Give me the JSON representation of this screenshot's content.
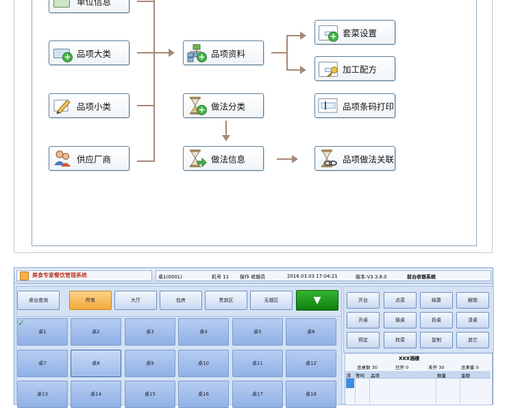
{
  "flow": {
    "nodes": {
      "unit_info": "单位信息",
      "item_category": "品项大类",
      "item_subcategory": "品项小类",
      "supplier": "供应厂商",
      "item_data": "品项资料",
      "method_category": "做法分类",
      "method_info": "做法信息",
      "set_meal": "套菜设置",
      "processing_recipe": "加工配方",
      "barcode_print": "品项条码打印",
      "item_method_link": "品项做法关联"
    }
  },
  "pos": {
    "app_title": "美食专家餐饮管理系统",
    "table_label": "桌1(0001)",
    "machine": "机号 11",
    "operator": "操作 收银员",
    "datetime": "2016.03.03 17:04:21",
    "version": "版本:V3.3.8.0",
    "system_name": "前台收银系统",
    "query_button": "桌台查询",
    "zones": [
      "所有",
      "大厅",
      "包房",
      "贵宾区",
      "无烟区"
    ],
    "tables": [
      "桌1",
      "桌2",
      "桌3",
      "桌4",
      "桌5",
      "桌6",
      "桌7",
      "桌8",
      "桌9",
      "桌10",
      "桌11",
      "桌12",
      "桌13",
      "桌14",
      "桌15",
      "桌16",
      "桌17",
      "桌18"
    ],
    "actions": [
      "开台",
      "点菜",
      "结算",
      "解锁",
      "开桌",
      "换桌",
      "拆桌",
      "清桌",
      "预定",
      "转菜",
      "复制",
      "其它"
    ],
    "summary": {
      "restaurant": "XXX酒楼",
      "total_tables": "总桌数 30",
      "opened": "已开 0",
      "not_opened": "未开 30",
      "total_guests": "总来客 0"
    },
    "order_columns": [
      "序",
      "等叫",
      "品项",
      "数量",
      "金额"
    ],
    "colors": {
      "accent_orange": "#f7b24a",
      "green_button": "#1f9a1f",
      "tile_blue": "#9db9ea"
    }
  }
}
